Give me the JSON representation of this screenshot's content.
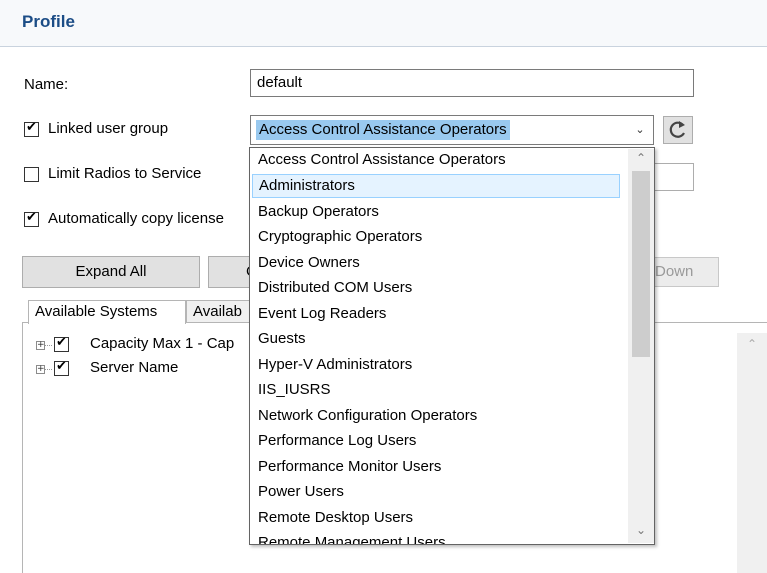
{
  "profile": {
    "title": "Profile",
    "name_label": "Name:",
    "name_value": "default",
    "linked_group_label": "Linked user group",
    "linked_group_checked": true,
    "linked_group_value": "Access Control Assistance Operators",
    "limit_radios_label": "Limit Radios to Service",
    "limit_radios_checked": false,
    "auto_copy_label": "Automatically copy license",
    "auto_copy_checked": true
  },
  "buttons": {
    "expand_all": "Expand All",
    "collapse_partial": "C",
    "down": "Down"
  },
  "tabs": [
    {
      "label": "Available Systems"
    },
    {
      "label": "Availab"
    }
  ],
  "tree": [
    {
      "label": "Capacity Max 1 - Cap",
      "checked": true
    },
    {
      "label": "Server Name",
      "checked": true
    }
  ],
  "dropdown": {
    "highlighted": "Administrators",
    "options": [
      "Access Control Assistance Operators",
      "Administrators",
      "Backup Operators",
      "Cryptographic Operators",
      "Device Owners",
      "Distributed COM Users",
      "Event Log Readers",
      "Guests",
      "Hyper-V Administrators",
      "IIS_IUSRS",
      "Network Configuration Operators",
      "Performance Log Users",
      "Performance Monitor Users",
      "Power Users",
      "Remote Desktop Users",
      "Remote Management Users"
    ]
  },
  "icons": {
    "refresh": "refresh-icon",
    "combo_arrow": "chevron-down-icon",
    "scroll_up": "chevron-up-icon",
    "scroll_down": "chevron-down-icon"
  },
  "colors": {
    "title": "#1c4d86",
    "selection": "#99c9ef",
    "hover": "#e5f3ff"
  }
}
